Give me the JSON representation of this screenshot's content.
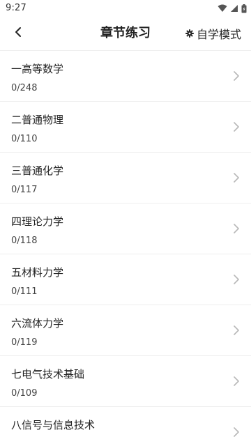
{
  "status_bar": {
    "time": "9:27"
  },
  "header": {
    "title": "章节练习",
    "action_label": "自学模式"
  },
  "chapters": [
    {
      "name": "一高等数学",
      "progress": "0/248"
    },
    {
      "name": "二普通物理",
      "progress": "0/110"
    },
    {
      "name": "三普通化学",
      "progress": "0/117"
    },
    {
      "name": "四理论力学",
      "progress": "0/118"
    },
    {
      "name": "五材料力学",
      "progress": "0/111"
    },
    {
      "name": "六流体力学",
      "progress": "0/119"
    },
    {
      "name": "七电气技术基础",
      "progress": "0/109"
    },
    {
      "name": "八信号与信息技术",
      "progress": ""
    }
  ],
  "icons": {
    "back": "chevron-left-icon",
    "settings": "gear-icon",
    "row_arrow": "chevron-right-icon",
    "wifi": "wifi-icon",
    "signal": "signal-icon",
    "battery": "battery-icon"
  },
  "colors": {
    "text_primary": "#222222",
    "divider": "#eeeeee",
    "chevron": "#b8b8b8"
  }
}
